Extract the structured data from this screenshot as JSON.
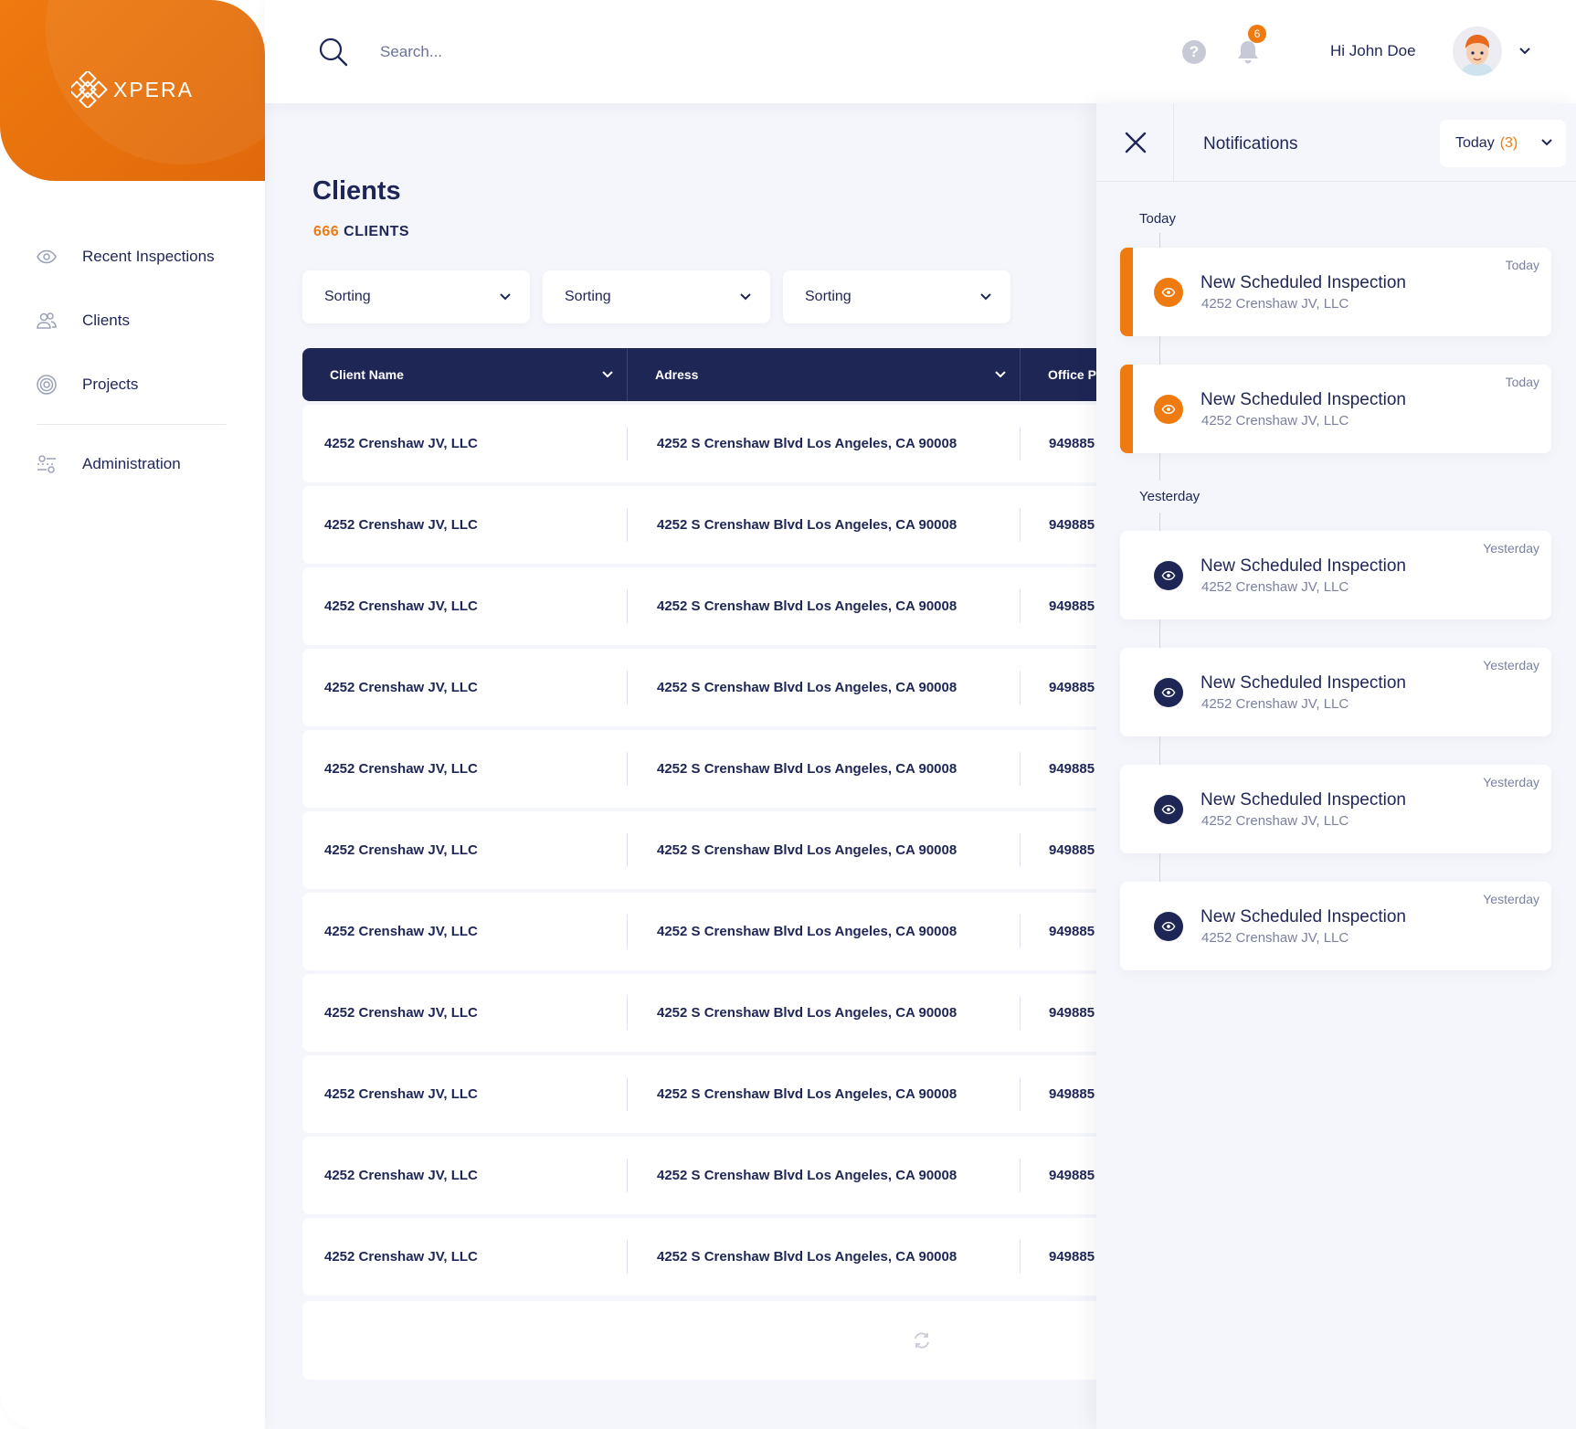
{
  "brand": {
    "name": "XPERA",
    "logo_icon": "xpera-diamond-logo",
    "accent": "#ee7a10",
    "navy": "#1e2656"
  },
  "sidebar": {
    "items": [
      {
        "label": "Recent Inspections",
        "icon": "eye-icon"
      },
      {
        "label": "Clients",
        "icon": "users-icon"
      },
      {
        "label": "Projects",
        "icon": "target-icon"
      },
      {
        "label": "Administration",
        "icon": "settings-sliders-icon"
      }
    ]
  },
  "topbar": {
    "search_placeholder": "Search...",
    "notifications_count": "6",
    "greeting": "Hi John Doe"
  },
  "main": {
    "title": "Clients",
    "count_number": "666",
    "count_label": "CLIENTS",
    "sorters": [
      "Sorting",
      "Sorting",
      "Sorting"
    ],
    "table": {
      "columns": [
        "Client Name",
        "Adress",
        "Office P"
      ],
      "rows": [
        [
          "4252 Crenshaw JV, LLC",
          "4252 S Crenshaw Blvd Los Angeles, CA 90008",
          "949885"
        ],
        [
          "4252 Crenshaw JV, LLC",
          "4252 S Crenshaw Blvd Los Angeles, CA 90008",
          "949885"
        ],
        [
          "4252 Crenshaw JV, LLC",
          "4252 S Crenshaw Blvd Los Angeles, CA 90008",
          "949885"
        ],
        [
          "4252 Crenshaw JV, LLC",
          "4252 S Crenshaw Blvd Los Angeles, CA 90008",
          "949885"
        ],
        [
          "4252 Crenshaw JV, LLC",
          "4252 S Crenshaw Blvd Los Angeles, CA 90008",
          "949885"
        ],
        [
          "4252 Crenshaw JV, LLC",
          "4252 S Crenshaw Blvd Los Angeles, CA 90008",
          "949885"
        ],
        [
          "4252 Crenshaw JV, LLC",
          "4252 S Crenshaw Blvd Los Angeles, CA 90008",
          "949885"
        ],
        [
          "4252 Crenshaw JV, LLC",
          "4252 S Crenshaw Blvd Los Angeles, CA 90008",
          "949885"
        ],
        [
          "4252 Crenshaw JV, LLC",
          "4252 S Crenshaw Blvd Los Angeles, CA 90008",
          "949885"
        ],
        [
          "4252 Crenshaw JV, LLC",
          "4252 S Crenshaw Blvd Los Angeles, CA 90008",
          "949885"
        ],
        [
          "4252 Crenshaw JV, LLC",
          "4252 S Crenshaw Blvd Los Angeles, CA 90008",
          "949885"
        ]
      ]
    }
  },
  "notifications": {
    "title": "Notifications",
    "filter_label": "Today",
    "filter_count": "(3)",
    "groups": [
      {
        "label": "Today",
        "items": [
          {
            "title": "New Scheduled Inspection",
            "subtitle": "4252 Crenshaw JV, LLC",
            "when": "Today",
            "unread": true
          },
          {
            "title": "New Scheduled Inspection",
            "subtitle": "4252 Crenshaw JV, LLC",
            "when": "Today",
            "unread": true
          }
        ]
      },
      {
        "label": "Yesterday",
        "items": [
          {
            "title": "New Scheduled Inspection",
            "subtitle": "4252 Crenshaw JV, LLC",
            "when": "Yesterday",
            "unread": false
          },
          {
            "title": "New Scheduled Inspection",
            "subtitle": "4252 Crenshaw JV, LLC",
            "when": "Yesterday",
            "unread": false
          },
          {
            "title": "New Scheduled Inspection",
            "subtitle": "4252 Crenshaw JV, LLC",
            "when": "Yesterday",
            "unread": false
          },
          {
            "title": "New Scheduled Inspection",
            "subtitle": "4252 Crenshaw JV, LLC",
            "when": "Yesterday",
            "unread": false
          }
        ]
      }
    ]
  }
}
